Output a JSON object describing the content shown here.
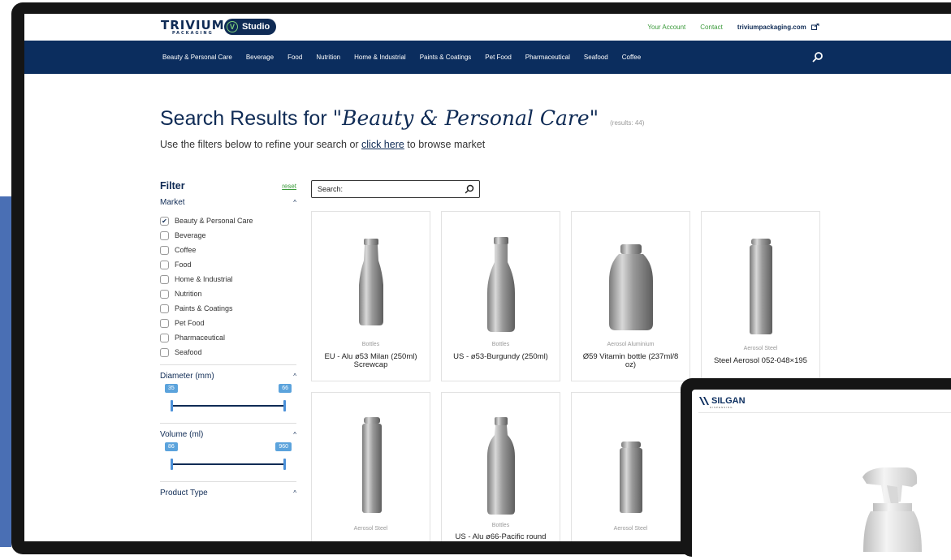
{
  "brand": {
    "name": "TRIVIUM",
    "sub": "PACKAGING",
    "studio": "Studio",
    "studio_mark": "V"
  },
  "toplinks": {
    "account": "Your Account",
    "contact": "Contact",
    "site": "triviumpackaging.com"
  },
  "nav": [
    "Beauty & Personal Care",
    "Beverage",
    "Food",
    "Nutrition",
    "Home & Industrial",
    "Paints & Coatings",
    "Pet Food",
    "Pharmaceutical",
    "Seafood",
    "Coffee"
  ],
  "heading": {
    "prefix": "Search Results for ",
    "query": "\"Beauty & Personal Care\"",
    "count": "(results: 44)"
  },
  "subheading": {
    "before": "Use the filters below to refine your search or ",
    "link": "click here",
    "after": " to browse market"
  },
  "filter": {
    "title": "Filter",
    "reset": "reset",
    "market": {
      "label": "Market",
      "caret": "^",
      "items": [
        {
          "label": "Beauty & Personal Care",
          "checked": true
        },
        {
          "label": "Beverage",
          "checked": false
        },
        {
          "label": "Coffee",
          "checked": false
        },
        {
          "label": "Food",
          "checked": false
        },
        {
          "label": "Home & Industrial",
          "checked": false
        },
        {
          "label": "Nutrition",
          "checked": false
        },
        {
          "label": "Paints & Coatings",
          "checked": false
        },
        {
          "label": "Pet Food",
          "checked": false
        },
        {
          "label": "Pharmaceutical",
          "checked": false
        },
        {
          "label": "Seafood",
          "checked": false
        }
      ]
    },
    "diameter": {
      "label": "Diameter (mm)",
      "caret": "^",
      "min": "35",
      "max": "66"
    },
    "volume": {
      "label": "Volume (ml)",
      "caret": "^",
      "min": "86",
      "max": "960"
    },
    "product_type": {
      "label": "Product Type",
      "caret": "^"
    }
  },
  "search": {
    "placeholder": "Search:"
  },
  "products": [
    {
      "category": "Bottles",
      "name": "EU - Alu ø53 Milan (250ml) Screwcap"
    },
    {
      "category": "Bottles",
      "name": "US - ø53-Burgundy (250ml)"
    },
    {
      "category": "Aerosol Aluminium",
      "name": "Ø59 Vitamin bottle (237ml/8 oz)"
    },
    {
      "category": "Aerosol Steel",
      "name": "Steel Aerosol 052-048×195"
    },
    {
      "category": "Aerosol Steel",
      "name": ""
    },
    {
      "category": "Bottles",
      "name": "US - Alu ø66-Pacific round"
    },
    {
      "category": "Aerosol Steel",
      "name": ""
    }
  ],
  "tablet": {
    "brand": "SILGAN",
    "brand_sub": "DISPENSING"
  },
  "colors": {
    "navy": "#0b2d5e",
    "green": "#3a9a3a",
    "slider": "#5ba3dc"
  }
}
